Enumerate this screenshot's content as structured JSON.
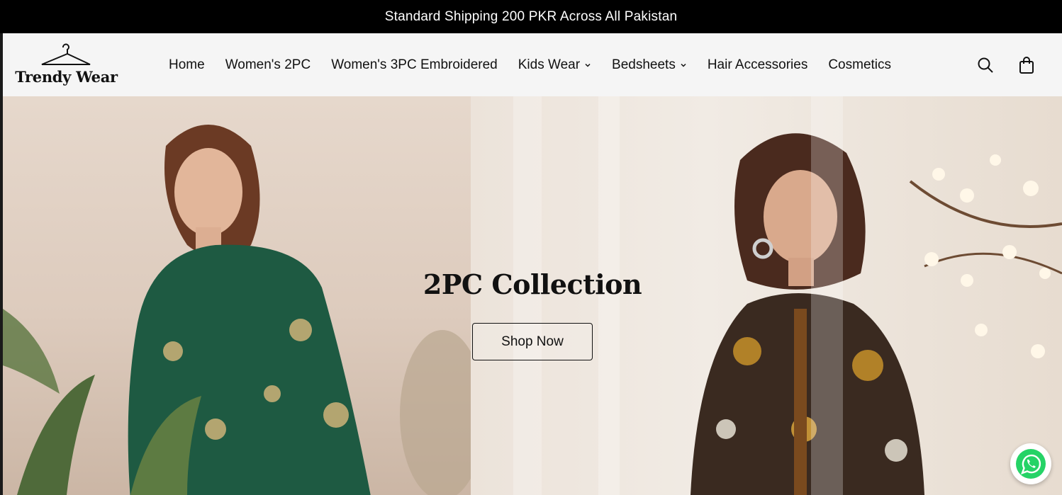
{
  "announcement": {
    "text": "Standard Shipping 200 PKR Across All Pakistan"
  },
  "header": {
    "logo_text": "Trendy Wear",
    "nav": [
      {
        "label": "Home",
        "has_dropdown": false
      },
      {
        "label": "Women's 2PC",
        "has_dropdown": false
      },
      {
        "label": "Women's 3PC Embroidered",
        "has_dropdown": false
      },
      {
        "label": "Kids Wear",
        "has_dropdown": true
      },
      {
        "label": "Bedsheets",
        "has_dropdown": true
      },
      {
        "label": "Hair Accessories",
        "has_dropdown": false
      },
      {
        "label": "Cosmetics",
        "has_dropdown": false
      }
    ],
    "icons": [
      "search-icon",
      "shopping-bag-icon"
    ]
  },
  "hero": {
    "title": "2PC Collection",
    "button_label": "Shop Now"
  },
  "floating": {
    "icon": "whatsapp-icon",
    "color": "#25D366"
  }
}
